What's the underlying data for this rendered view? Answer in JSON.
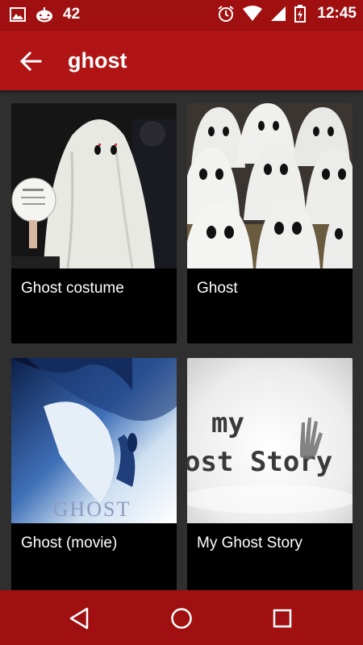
{
  "status_bar": {
    "notification_count": "42",
    "time": "12:45"
  },
  "app_bar": {
    "title": "ghost"
  },
  "results": [
    {
      "label": "Ghost costume",
      "image": "person-in-white-sheet-ghost-costume"
    },
    {
      "label": "Ghost",
      "image": "rows-of-sheet-ghosts"
    },
    {
      "label": "Ghost (movie)",
      "image": "ghost-movie-poster-blue-couple"
    },
    {
      "label": "My Ghost Story",
      "image": "my-ghost-story-title-card-hand"
    }
  ],
  "colors": {
    "status_bar": "#a01010",
    "app_bar": "#b01414",
    "background": "#2f2f2f",
    "card": "#000000"
  }
}
